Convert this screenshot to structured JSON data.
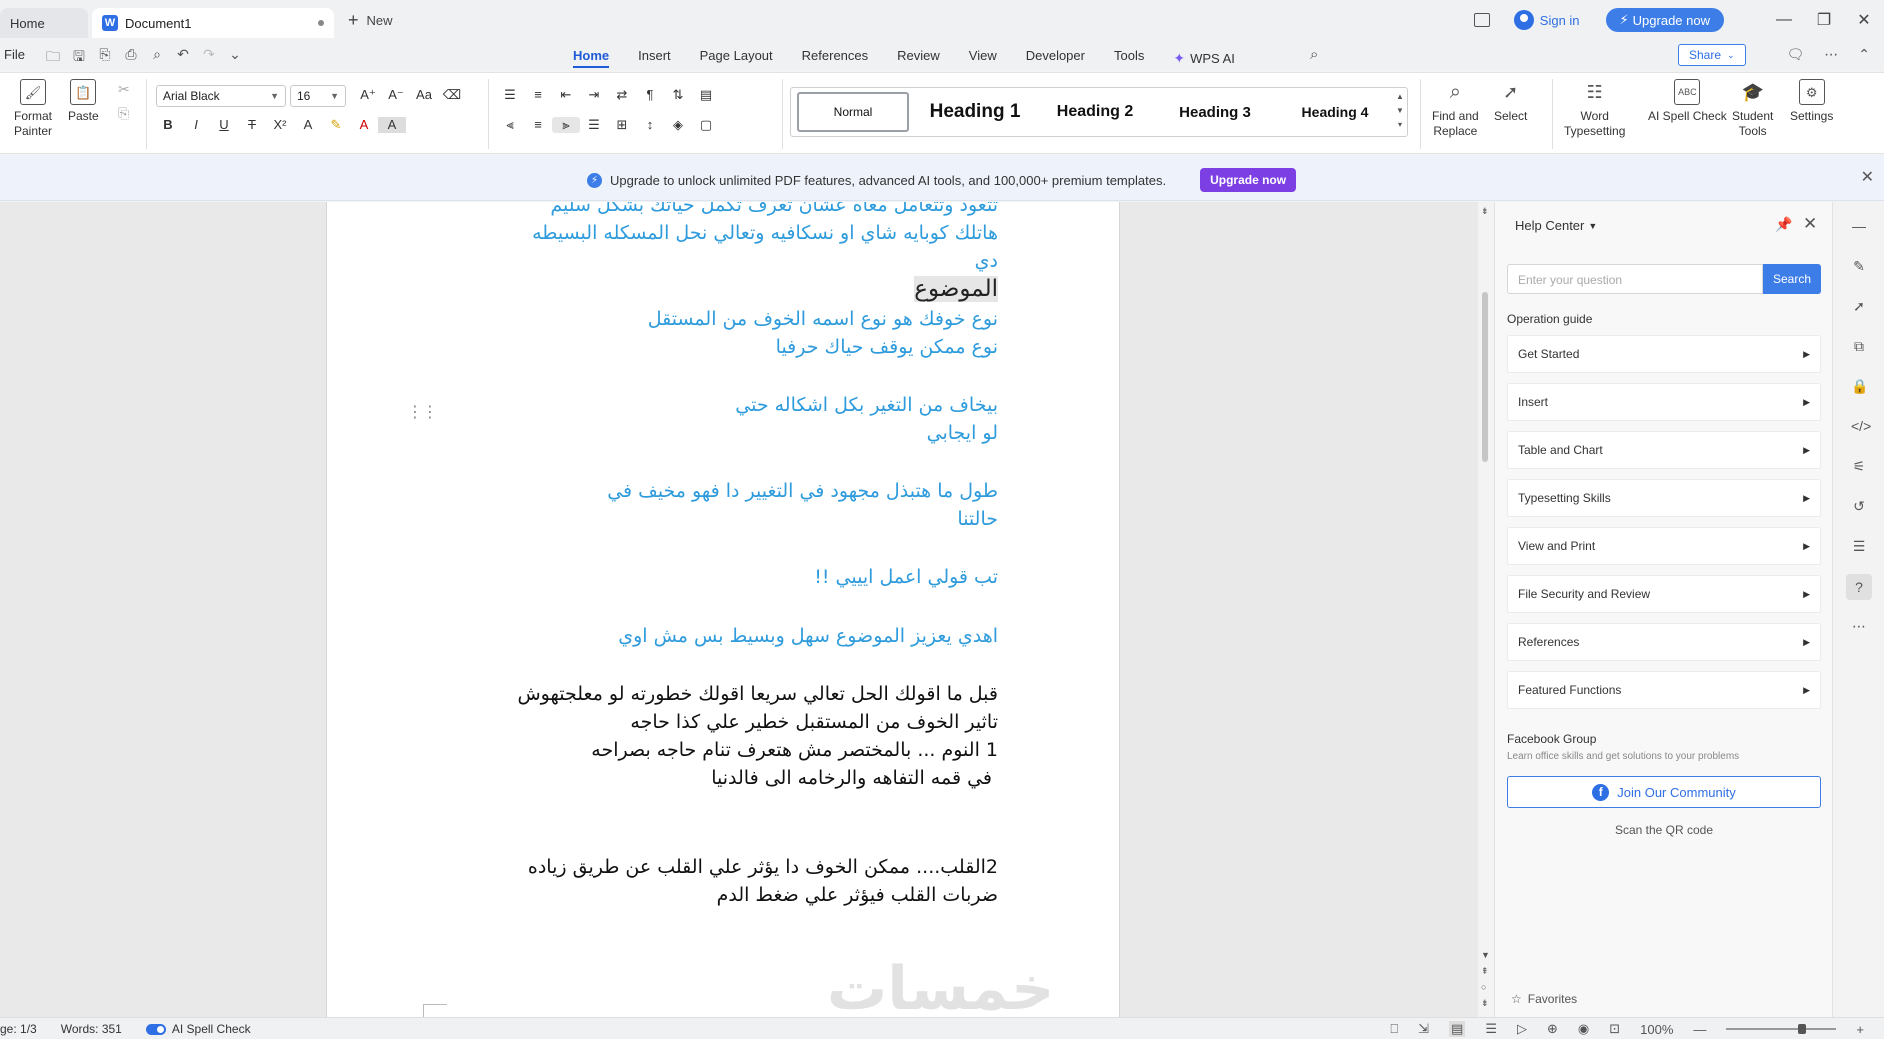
{
  "titlebar": {
    "home_tab": "Home",
    "doc_tab": "Document1",
    "new_tab": "New",
    "signin": "Sign in",
    "upgrade": "Upgrade now"
  },
  "menu": {
    "file": "File",
    "tabs": [
      "Home",
      "Insert",
      "Page Layout",
      "References",
      "Review",
      "View",
      "Developer",
      "Tools"
    ],
    "wps_ai": "WPS AI",
    "share": "Share"
  },
  "ribbon": {
    "format_painter": "Format\nPainter",
    "paste": "Paste",
    "font_name": "Arial Black",
    "font_size": "16",
    "styles": [
      "Normal",
      "Heading 1",
      "Heading 2",
      "Heading 3",
      "Heading 4"
    ],
    "find_replace": "Find and\nReplace",
    "select": "Select",
    "word_typesetting": "Word\nTypesetting",
    "ai_spell_check": "AI Spell Check",
    "student_tools": "Student\nTools",
    "settings": "Settings"
  },
  "banner": {
    "text": "Upgrade to unlock unlimited PDF features, advanced AI tools, and 100,000+ premium templates.",
    "button": "Upgrade now"
  },
  "document": {
    "lines": [
      "تتعود وتتعامل معاه عشان  تعرف تكمل حياتك بشكل سليم",
      "هاتلك كوبايه شاي او نسكافيه وتعالي نحل المسكله البسيطه",
      "دي",
      "الموضوع",
      "نوع خوفك هو نوع اسمه الخوف من المستقل",
      "نوع ممكن يوقف حياك حرفيا",
      "بيخاف من التغير بكل اشكاله حتي",
      "لو ايجابي",
      "طول  ما هتبذل مجهود في التغيير دا فهو مخيف في",
      "حالتنا",
      "تب قولي اعمل ايييي !!",
      "اهدي يعزيز الموضوع سهل وبسيط بس مش اوي",
      "قبل ما اقولك الحل تعالي سريعا اقولك خطورته لو معلجتهوش",
      "تاثير  الخوف من المستقبل خطير علي كذا حاجه",
      "1 النوم ... بالمختصر مش هتعرف تنام حاجه بصراحه",
      "في قمه التفاهه والرخامه الى فالدنيا",
      "2القلب....  ممكن  الخوف دا يؤثر علي القلب عن طريق زياده",
      "ضربات القلب فيؤثر علي ضغط الدم"
    ]
  },
  "help": {
    "title": "Help Center",
    "search_placeholder": "Enter your question",
    "search_button": "Search",
    "operation_guide": "Operation guide",
    "items": [
      "Get Started",
      "Insert",
      "Table and Chart",
      "Typesetting Skills",
      "View and Print",
      "File Security and Review",
      "References",
      "Featured Functions"
    ],
    "facebook_group": "Facebook Group",
    "facebook_sub": "Learn office skills and get solutions to your problems",
    "join": "Join Our Community",
    "qr": "Scan the QR code",
    "favorites": "Favorites"
  },
  "status": {
    "page": "ge: 1/3",
    "words": "Words: 351",
    "spell": "AI Spell Check",
    "zoom": "100%"
  },
  "colors": {
    "accent": "#3c7de8",
    "doc_blue_text": "#2e9bdc",
    "banner_button": "#7b3fe4"
  }
}
